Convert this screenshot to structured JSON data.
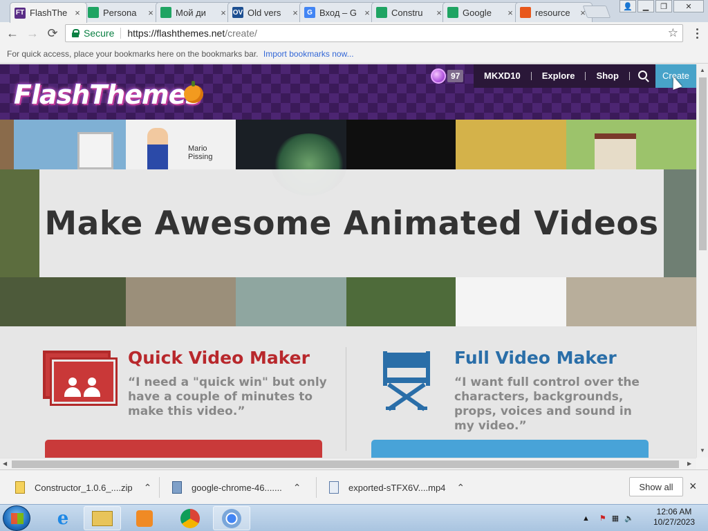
{
  "browser": {
    "tabs": [
      {
        "title": "FlashThe",
        "favicon_text": "FT",
        "favicon_color": "#5a2d86",
        "active": true
      },
      {
        "title": "Persona",
        "favicon_text": "",
        "favicon_color": "#1fa463",
        "active": false
      },
      {
        "title": "Мой ди",
        "favicon_text": "",
        "favicon_color": "#1fa463",
        "active": false
      },
      {
        "title": "Old vers",
        "favicon_text": "OV",
        "favicon_color": "#1d4f91",
        "active": false
      },
      {
        "title": "Вход – G",
        "favicon_text": "G",
        "favicon_color": "#4285f4",
        "active": false
      },
      {
        "title": "Constru",
        "favicon_text": "",
        "favicon_color": "#1fa463",
        "active": false
      },
      {
        "title": "Google",
        "favicon_text": "",
        "favicon_color": "#1fa463",
        "active": false
      },
      {
        "title": "resource",
        "favicon_text": "",
        "favicon_color": "#e8581c",
        "active": false
      }
    ],
    "tab_close": "×",
    "secure_label": "Secure",
    "url_host": "https://flashthemes.net",
    "url_path": "/create/",
    "bookmark_hint": "For quick access, place your bookmarks here on the bookmarks bar.",
    "import_link": "Import bookmarks now...",
    "back_glyph": "←",
    "forward_glyph": "→",
    "reload_glyph": "⟳",
    "star_glyph": "☆"
  },
  "site": {
    "logo_text": "FlashThemes",
    "joy_count": "97",
    "nav": {
      "user": "MKXD10",
      "explore": "Explore",
      "shop": "Shop",
      "create": "Create"
    },
    "hero_title": "Make Awesome Animated Videos",
    "hero_tile_caption": "Mario\nPissing",
    "quick": {
      "title": "Quick Video Maker",
      "quote": "“I need a \"quick win\" but only have a couple of minutes to make this video.”",
      "color": "#b8282c"
    },
    "full": {
      "title": "Full Video Maker",
      "quote": "“I want full control over the characters, backgrounds, props, voices and sound in my video.”",
      "color": "#2a6ea8"
    }
  },
  "downloads": {
    "items": [
      {
        "name": "Constructor_1.0.6_....zip"
      },
      {
        "name": "google-chrome-46......."
      },
      {
        "name": "exported-sTFX6V....mp4"
      }
    ],
    "show_all": "Show all",
    "close": "×"
  },
  "taskbar": {
    "time": "12:06 AM",
    "date": "10/27/2023"
  }
}
